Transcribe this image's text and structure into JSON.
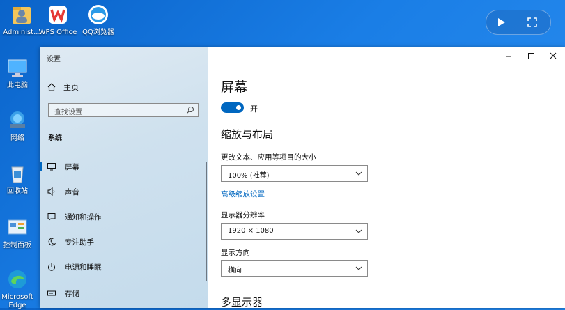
{
  "desktop": {
    "icons": [
      {
        "label": "Administ...",
        "icon": "user-folder-icon"
      },
      {
        "label": "WPS Office",
        "icon": "wps-office-icon"
      },
      {
        "label": "QQ浏览器",
        "icon": "qq-browser-icon"
      },
      {
        "label": "此电脑",
        "icon": "computer-icon"
      },
      {
        "label": "网络",
        "icon": "network-icon"
      },
      {
        "label": "回收站",
        "icon": "recycle-bin-icon"
      },
      {
        "label": "控制面板",
        "icon": "control-panel-icon"
      },
      {
        "label": "Microsoft Edge",
        "icon": "edge-icon"
      }
    ]
  },
  "remote_bar": {
    "icons": [
      "pointer-flag-icon",
      "fullscreen-icon"
    ]
  },
  "window": {
    "app_title": "设置",
    "controls": {
      "minimize": "minimize-icon",
      "maximize": "maximize-icon",
      "close": "close-icon"
    }
  },
  "nav": {
    "home": "主页",
    "search_placeholder": "查找设置",
    "section": "系统",
    "items": [
      {
        "label": "屏幕",
        "icon": "monitor-icon",
        "active": true
      },
      {
        "label": "声音",
        "icon": "speaker-icon"
      },
      {
        "label": "通知和操作",
        "icon": "notification-icon"
      },
      {
        "label": "专注助手",
        "icon": "moon-icon"
      },
      {
        "label": "电源和睡眠",
        "icon": "power-icon"
      },
      {
        "label": "存储",
        "icon": "storage-icon"
      }
    ]
  },
  "main": {
    "title": "屏幕",
    "night_light": {
      "state": "开",
      "on": true
    },
    "scale_heading": "缩放与布局",
    "scale_label": "更改文本、应用等项目的大小",
    "scale_value": "100% (推荐)",
    "advanced_link": "高级缩放设置",
    "resolution_label": "显示器分辨率",
    "resolution_value": "1920 × 1080",
    "orientation_label": "显示方向",
    "orientation_value": "横向",
    "multi_heading": "多显示器"
  },
  "colors": {
    "accent": "#0067c0",
    "desktop": "#1a7ee6"
  }
}
